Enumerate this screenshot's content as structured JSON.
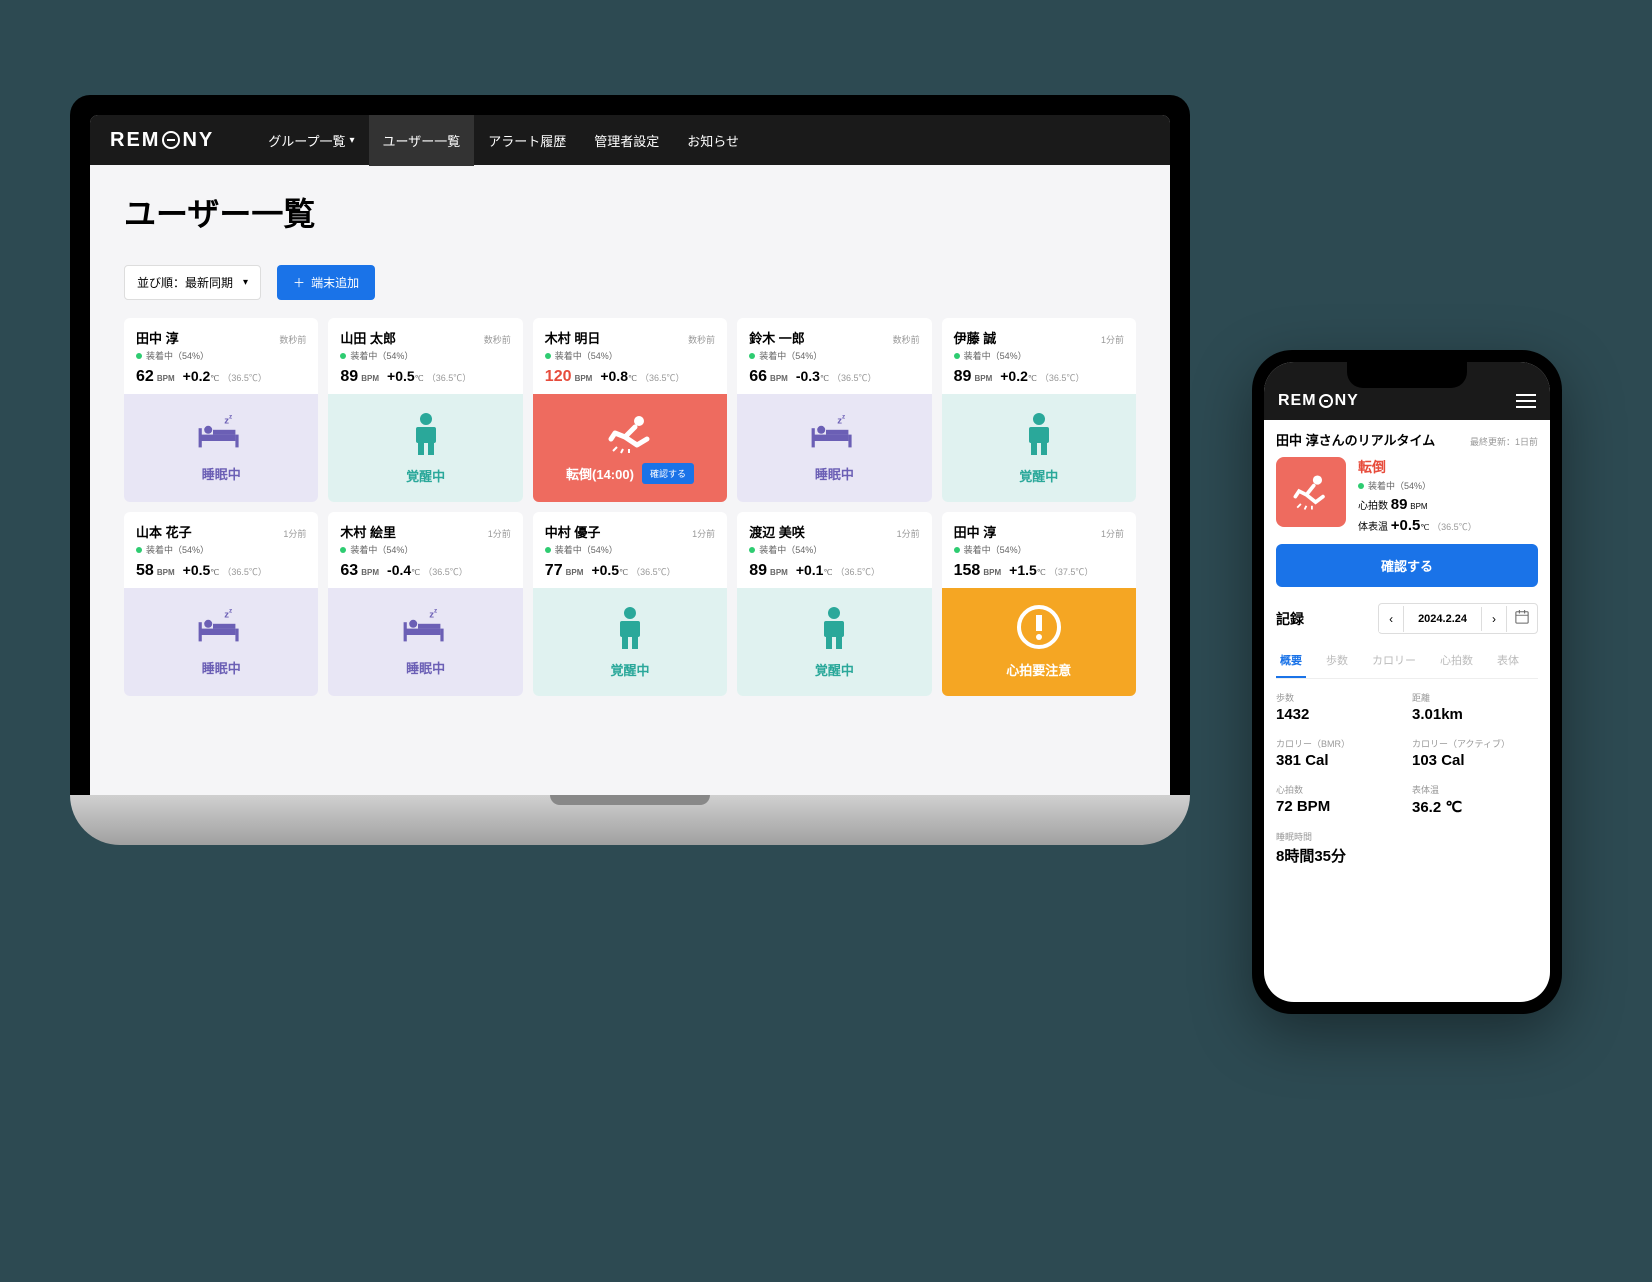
{
  "brand": "REMONY",
  "nav": {
    "items": [
      {
        "label": "グループ一覧",
        "active": false,
        "chevron": true
      },
      {
        "label": "ユーザー一覧",
        "active": true
      },
      {
        "label": "アラート履歴",
        "active": false
      },
      {
        "label": "管理者設定",
        "active": false
      },
      {
        "label": "お知らせ",
        "active": false
      }
    ]
  },
  "page": {
    "title": "ユーザー一覧",
    "sort_label": "並び順：最新同期",
    "add_label": "端末追加"
  },
  "users": [
    {
      "name": "田中 淳",
      "time": "数秒前",
      "status": "装着中（54%）",
      "bpm": "62",
      "temp": "+0.2",
      "abs": "（36.5℃）",
      "state": "sleep",
      "state_label": "睡眠中"
    },
    {
      "name": "山田 太郎",
      "time": "数秒前",
      "status": "装着中（54%）",
      "bpm": "89",
      "temp": "+0.5",
      "abs": "（36.5℃）",
      "state": "awake",
      "state_label": "覚醒中"
    },
    {
      "name": "木村 明日",
      "time": "数秒前",
      "status": "装着中（54%）",
      "bpm": "120",
      "bpm_red": true,
      "temp": "+0.8",
      "abs": "（36.5℃）",
      "state": "fall",
      "state_label": "転倒(14:00)",
      "confirm": "確認する"
    },
    {
      "name": "鈴木 一郎",
      "time": "数秒前",
      "status": "装着中（54%）",
      "bpm": "66",
      "temp": "-0.3",
      "abs": "（36.5℃）",
      "state": "sleep",
      "state_label": "睡眠中"
    },
    {
      "name": "伊藤 誠",
      "time": "1分前",
      "status": "装着中（54%）",
      "bpm": "89",
      "temp": "+0.2",
      "abs": "（36.5℃）",
      "state": "awake",
      "state_label": "覚醒中"
    },
    {
      "name": "山本 花子",
      "time": "1分前",
      "status": "装着中（54%）",
      "bpm": "58",
      "temp": "+0.5",
      "abs": "（36.5℃）",
      "state": "sleep",
      "state_label": "睡眠中"
    },
    {
      "name": "木村 絵里",
      "time": "1分前",
      "status": "装着中（54%）",
      "bpm": "63",
      "temp": "-0.4",
      "abs": "（36.5℃）",
      "state": "sleep",
      "state_label": "睡眠中"
    },
    {
      "name": "中村 優子",
      "time": "1分前",
      "status": "装着中（54%）",
      "bpm": "77",
      "temp": "+0.5",
      "abs": "（36.5℃）",
      "state": "awake",
      "state_label": "覚醒中"
    },
    {
      "name": "渡辺 美咲",
      "time": "1分前",
      "status": "装着中（54%）",
      "bpm": "89",
      "temp": "+0.1",
      "abs": "（36.5℃）",
      "state": "awake",
      "state_label": "覚醒中"
    },
    {
      "name": "田中 淳",
      "time": "1分前",
      "status": "装着中（54%）",
      "bpm": "158",
      "temp": "+1.5",
      "abs": "（37.5℃）",
      "state": "heart",
      "state_label": "心拍要注意"
    }
  ],
  "units": {
    "bpm": "BPM",
    "deg": "℃"
  },
  "phone": {
    "realtime_title": "田中 淳さんのリアルタイム",
    "last_update": "最終更新：1日前",
    "alert": {
      "title": "転倒",
      "status": "装着中（54%）",
      "hr_label": "心拍数",
      "hr_val": "89",
      "hr_unit": "BPM",
      "temp_label": "体表温",
      "temp_val": "+0.5",
      "temp_unit": "℃",
      "temp_abs": "（36.5℃）",
      "confirm": "確認する"
    },
    "records": {
      "title": "記録",
      "date": "2024.2.24",
      "tabs": [
        "概要",
        "歩数",
        "カロリー",
        "心拍数",
        "表体"
      ],
      "active_tab": 0,
      "stats": [
        {
          "label": "歩数",
          "val": "1432"
        },
        {
          "label": "距離",
          "val": "3.01km"
        },
        {
          "label": "カロリー（BMR）",
          "val": "381 Cal"
        },
        {
          "label": "カロリー（アクティブ）",
          "val": "103 Cal"
        },
        {
          "label": "心拍数",
          "val": "72 BPM"
        },
        {
          "label": "表体温",
          "val": "36.2 ℃"
        },
        {
          "label": "睡眠時間",
          "val": "8時間35分",
          "full": true
        }
      ]
    }
  }
}
